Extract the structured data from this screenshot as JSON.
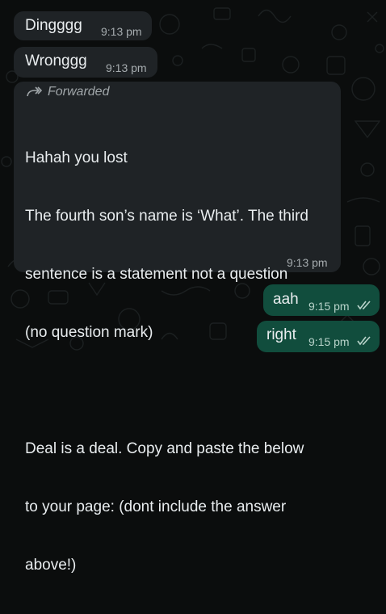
{
  "chat": {
    "messages": [
      {
        "text": "Dingggg",
        "time": "9:13 pm"
      },
      {
        "text": "Wronggg",
        "time": "9:13 pm"
      },
      {
        "forwarded_label": "Forwarded",
        "lines": [
          "Hahah you lost",
          "The fourth son’s name is ‘What’. The third",
          "sentence is a statement not a question",
          "(no question mark)",
          "",
          "Deal is a deal. Copy and paste the below",
          "to your page: (dont include the answer",
          "above!)"
        ],
        "time": "9:13 pm"
      },
      {
        "text": "aah",
        "time": "9:15 pm",
        "status": "read"
      },
      {
        "text": "right",
        "time": "9:15 pm",
        "status": "read"
      }
    ]
  },
  "colors": {
    "background": "#0b0d0d",
    "incoming_bubble": "#1f2326",
    "outgoing_bubble": "#114d3d",
    "read_ticks": "#b9d4cb"
  },
  "icons": {
    "forward": "forward-arrow-icon",
    "read_receipt": "double-check-icon"
  }
}
